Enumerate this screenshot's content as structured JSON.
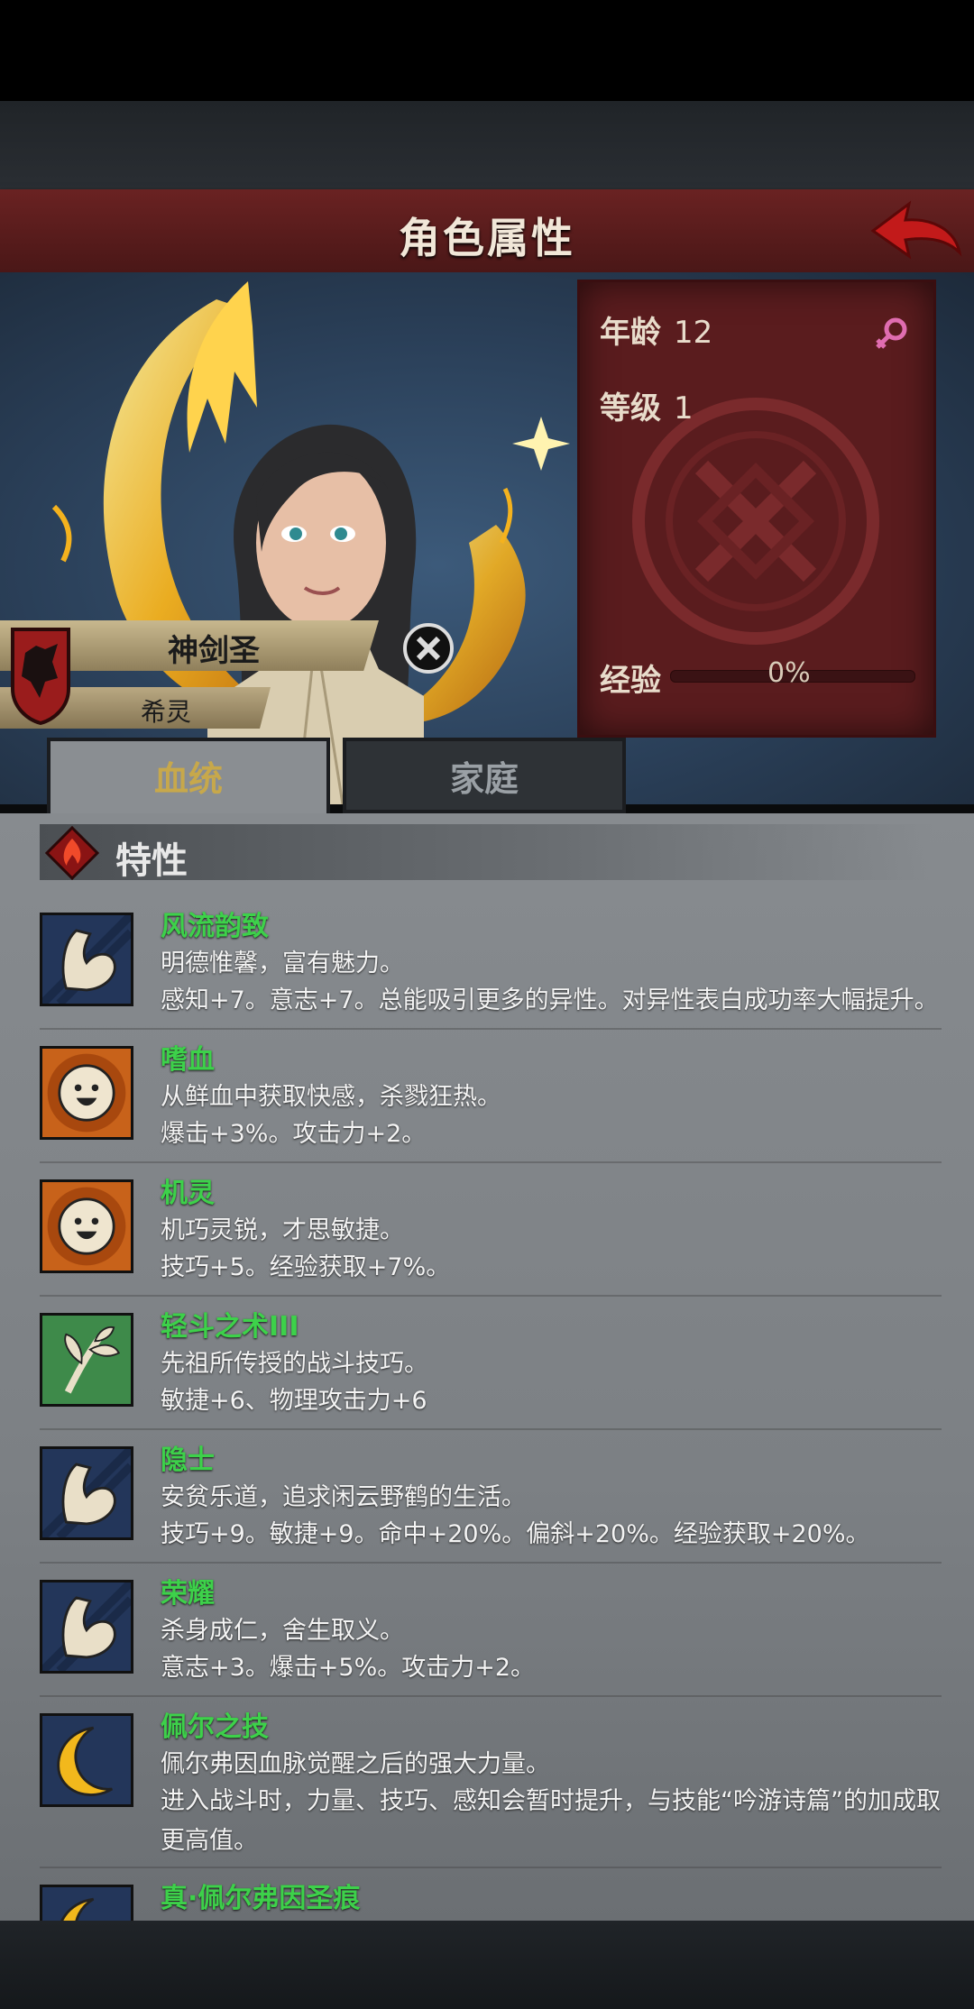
{
  "header": {
    "title": "角色属性"
  },
  "character": {
    "name": "神剑圣",
    "origin": "希灵",
    "stats": {
      "age_label": "年龄",
      "age_value": "12",
      "level_label": "等级",
      "level_value": "1",
      "exp_label": "经验",
      "exp_value": "0%",
      "exp_progress": 0
    }
  },
  "tabs": [
    {
      "label": "血统",
      "active": true
    },
    {
      "label": "家庭",
      "active": false
    }
  ],
  "section": {
    "title": "特性"
  },
  "traits": [
    {
      "icon": "flexed-arm-icon",
      "name": "风流韵致",
      "desc": "明德惟馨，富有魅力。",
      "effect": "感知+7。意志+7。总能吸引更多的异性。对异性表白成功率大幅提升。"
    },
    {
      "icon": "smiley-sun-icon",
      "name": "嗜血",
      "desc": "从鲜血中获取快感，杀戮狂热。",
      "effect": "爆击+3%。攻击力+2。"
    },
    {
      "icon": "smiley-sun-icon",
      "name": "机灵",
      "desc": "机巧灵锐，才思敏捷。",
      "effect": "技巧+5。经验获取+7%。"
    },
    {
      "icon": "leaf-branch-icon",
      "name": "轻斗之术III",
      "desc": "先祖所传授的战斗技巧。",
      "effect": "敏捷+6、物理攻击力+6"
    },
    {
      "icon": "flexed-arm-icon",
      "name": "隐士",
      "desc": "安贫乐道，追求闲云野鹤的生活。",
      "effect": "技巧+9。敏捷+9。命中+20%。偏斜+20%。经验获取+20%。"
    },
    {
      "icon": "flexed-arm-icon",
      "name": "荣耀",
      "desc": "杀身成仁，舍生取义。",
      "effect": "意志+3。爆击+5%。攻击力+2。"
    },
    {
      "icon": "crescent-moon-icon",
      "name": "佩尔之技",
      "desc": "佩尔弗因血脉觉醒之后的强大力量。",
      "effect": "进入战斗时，力量、技巧、感知会暂时提升，与技能“吟游诗篇”的加成取更高值。"
    },
    {
      "icon": "crescent-moon-icon",
      "name": "真·佩尔弗因圣痕",
      "desc": "",
      "effect": ""
    }
  ],
  "colors": {
    "trait_name": "#3dd14a",
    "title_bar": "#5a1c1e",
    "active_tab_text": "#c7a84b"
  }
}
